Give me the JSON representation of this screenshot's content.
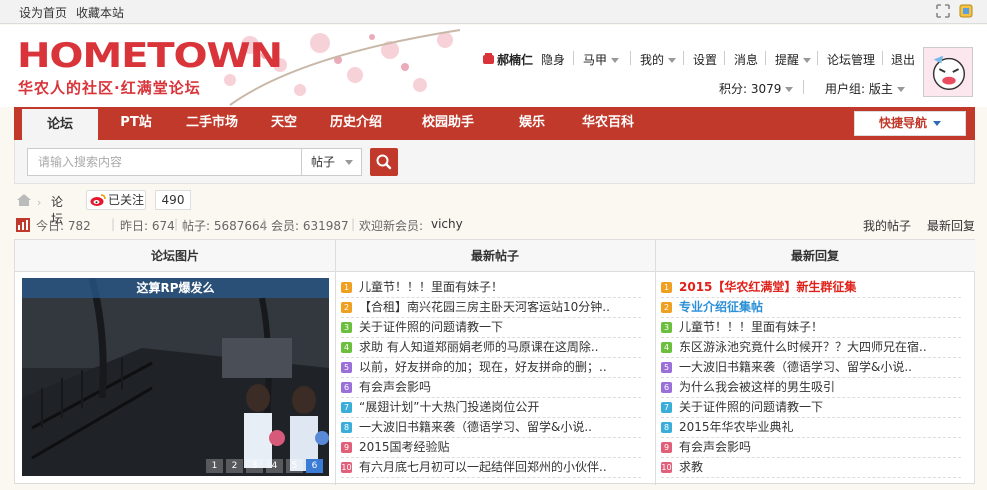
{
  "topbar": {
    "set_home": "设为首页",
    "bookmark": "收藏本站"
  },
  "logo": {
    "text": "HOMETOWN",
    "subtitle": "华农人的社区·红满堂论坛"
  },
  "user_menu": {
    "username": "郝楠仁",
    "status": "隐身",
    "items": [
      "马甲",
      "我的",
      "设置",
      "消息",
      "提醒",
      "论坛管理",
      "退出"
    ],
    "points": "积分: 3079",
    "user_group": "用户组: 版主"
  },
  "nav": {
    "items": [
      "论坛",
      "PT站",
      "二手市场",
      "天空",
      "历史介绍",
      "校园助手",
      "娱乐",
      "华农百科"
    ],
    "quick_nav": "快捷导航"
  },
  "search": {
    "placeholder": "请输入搜索内容",
    "type": "帖子"
  },
  "breadcrumb": {
    "forum": "论坛",
    "followed": "已关注",
    "follow_count": "490"
  },
  "stats": {
    "today": "今日: 782",
    "yesterday": "昨日: 674",
    "posts": "帖子: 5687664",
    "members": "会员: 631987",
    "welcome": "欢迎新会员:",
    "new_member": "vichy",
    "my_posts": "我的帖子",
    "latest_replies": "最新回复"
  },
  "panel": {
    "photos": {
      "header": "论坛图片",
      "caption": "这算RP爆发么",
      "pages": [
        "1",
        "2",
        "3",
        "4",
        "5",
        "6"
      ],
      "active_page": 6
    },
    "latest_posts": {
      "header": "最新帖子",
      "items": [
        "儿童节！！！里面有妹子！",
        "【合租】南兴花园三房主卧天河客运站10分钟..",
        "关于证件照的问题请教一下",
        "求助 有人知道郑丽娟老师的马原课在这周除..",
        "以前，好友拼命的加；现在，好友拼命的删；..",
        "有会声会影吗",
        "“展翅计划”十大热门投递岗位公开",
        "一大波旧书籍来袭（德语学习、留学&小说..",
        "2015国考经验贴",
        "有六月底七月初可以一起结伴回郑州的小伙伴.."
      ]
    },
    "latest_replies": {
      "header": "最新回复",
      "items": [
        "2015【华农红满堂】新生群征集",
        "专业介绍征集帖",
        "儿童节！！！里面有妹子！",
        "东区游泳池究竟什么时候开？？大四师兄在宿..",
        "一大波旧书籍来袭（德语学习、留学&小说..",
        "为什么我会被这样的男生吸引",
        "关于证件照的问题请教一下",
        "2015年华农毕业典礼",
        "有会声会影吗",
        "求教"
      ]
    }
  },
  "colors": {
    "brand_red": "#c0392b",
    "accent_blue": "#2b8fd8",
    "highlight_red": "#e0211a"
  }
}
